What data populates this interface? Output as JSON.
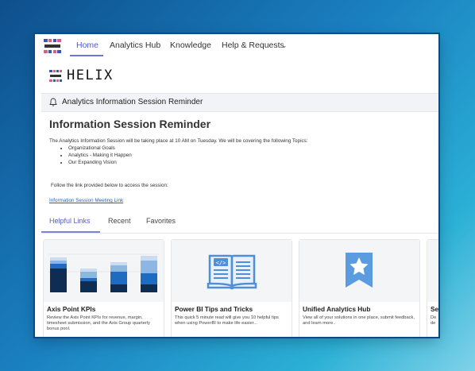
{
  "nav": {
    "items": [
      {
        "label": "Home",
        "active": true
      },
      {
        "label": "Analytics Hub",
        "active": false
      },
      {
        "label": "Knowledge",
        "active": false
      },
      {
        "label": "Help & Requests",
        "active": false
      }
    ],
    "dropdown_icon": "chevron-down-icon"
  },
  "brand": {
    "wordmark": "HELIX"
  },
  "banner": {
    "icon": "bell-icon",
    "text": "Analytics Information Session Reminder"
  },
  "announcement": {
    "title": "Information Session Reminder",
    "intro": "The Analytics Information Session will be taking place at 10 AM on Tuesday.  We will be covering the following Topics:",
    "topics": [
      "Organizational Goals",
      "Analytics - Making it Happen",
      "Our Expanding Vision"
    ],
    "follow": "Follow the link provided below to access the session:",
    "link_text": "Information Session Meeting Link"
  },
  "tabs": [
    "Helpful Links",
    "Recent",
    "Favorites"
  ],
  "cards": [
    {
      "title": "Axis Point KPIs",
      "desc": "Review the Axis Point KPIs for revenue, margin, timesheet submission, and the Axis Group quarterly bonus pool."
    },
    {
      "title": "Power BI Tips and Tricks",
      "desc": "This quick 5 minute read will give you 10 helpful tips when using PowerBI to make life easier..."
    },
    {
      "title": "Unified Analytics Hub",
      "desc": "View all of your solutions in one place, submit feedback, and learn more.."
    },
    {
      "title": "Se",
      "desc": "De\nde"
    }
  ],
  "colors": {
    "accent": "#4b5bd0",
    "link": "#2a5db0",
    "icon_blue": "#5b9be0",
    "bar_dark": "#0f2d52",
    "bar_mid": "#1e6bbf",
    "bar_light": "#8db7e3"
  }
}
